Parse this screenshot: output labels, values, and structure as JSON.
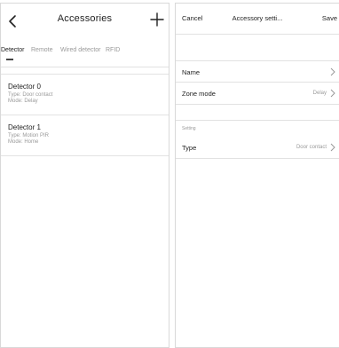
{
  "left": {
    "title": "Accessories",
    "tabs": [
      "Detector",
      "Remote",
      "Wired detector",
      "RFID"
    ],
    "active_tab": "Detector",
    "detectors": [
      {
        "name": "Detector 0",
        "type": "Type: Door contact",
        "mode": "Mode: Delay"
      },
      {
        "name": "Detector 1",
        "type": "Type: Motion PIR",
        "mode": "Mode: Home"
      }
    ]
  },
  "right": {
    "cancel": "Cancel",
    "title": "Accessory setti...",
    "save": "Save",
    "name_label": "Name",
    "zone_mode_label": "Zone mode",
    "zone_mode_value": "Delay",
    "section_title": "Setting",
    "type_label": "Type",
    "type_value": "Door contact"
  },
  "icons": {
    "back": "chevron-left-icon",
    "add": "plus-icon",
    "row_chevron": "chevron-right-icon"
  },
  "colors": {
    "background": "#ffffff",
    "text": "#222222",
    "secondary_text": "#9a9a9a",
    "divider": "#e2e2e2"
  }
}
